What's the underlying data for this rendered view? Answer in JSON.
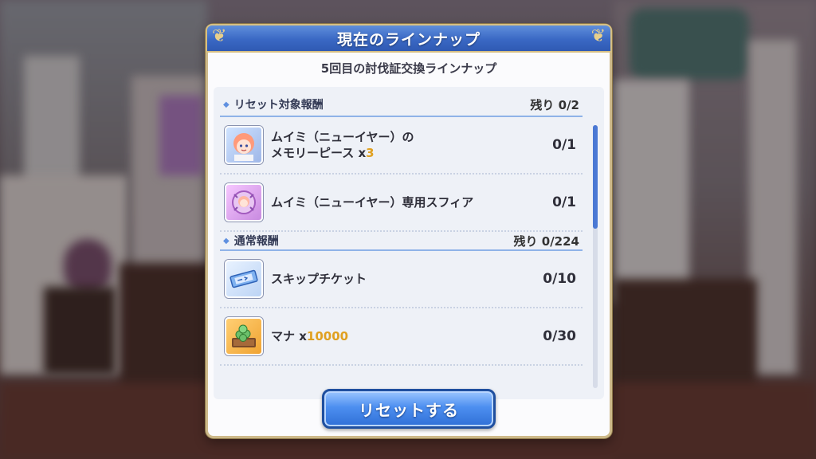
{
  "dialog": {
    "title": "現在のラインナップ",
    "subtitle": "5回目の討伐証交換ラインナップ"
  },
  "sections": [
    {
      "name": "リセット対象報酬",
      "remaining": "残り 0/2",
      "items": [
        {
          "icon": "memory-piece-icon",
          "name_line1": "ムイミ（ニューイヤー）の",
          "name_line2": "メモリーピース x",
          "quantity": "3",
          "count": "0/1"
        },
        {
          "icon": "sphere-icon",
          "name_line1": "ムイミ（ニューイヤー）専用スフィア",
          "count": "0/1"
        }
      ]
    },
    {
      "name": "通常報酬",
      "remaining": "残り 0/224",
      "items": [
        {
          "icon": "skip-ticket-icon",
          "name_line1": "スキップチケット",
          "count": "0/10"
        },
        {
          "icon": "mana-icon",
          "name_prefix": "マナ x",
          "quantity": "10000",
          "count": "0/30"
        }
      ]
    }
  ],
  "reset_button": {
    "label": "リセットする"
  },
  "colors": {
    "title_bar": "#3a68c4",
    "accent_quantity": "#e0a020",
    "button": "#4d8ff0"
  }
}
